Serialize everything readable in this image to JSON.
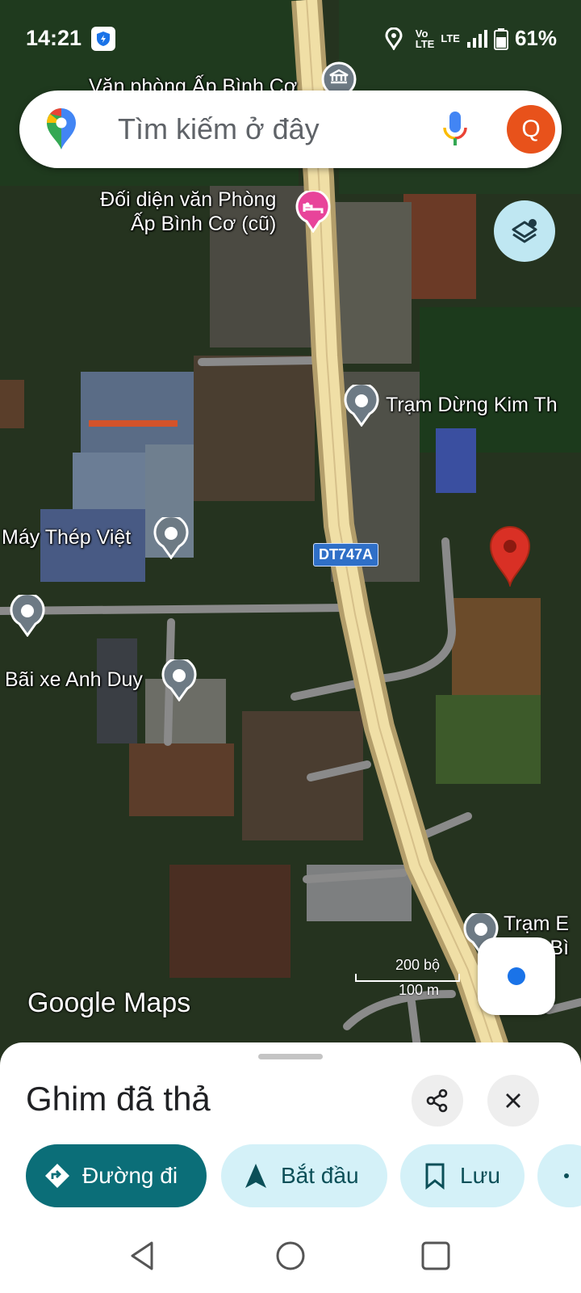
{
  "status_bar": {
    "time": "14:21",
    "battery": "61%",
    "network_label": "LTE"
  },
  "search": {
    "placeholder": "Tìm kiếm ở đây",
    "avatar_letter": "Q"
  },
  "map": {
    "road_shield": "DT747A",
    "google_logo": "Google Maps",
    "scale_top": "200 bộ",
    "scale_bottom": "100 m",
    "pois": [
      {
        "label": "Văn phòng Ấp Bình Cơ"
      },
      {
        "label": "Đối diện văn Phòng",
        "label2": "Ấp Bình Cơ (cũ)"
      },
      {
        "label": "Trạm Dừng Kim Th"
      },
      {
        "label": "Máy Thép Việt"
      },
      {
        "label": "Bãi xe Anh Duy"
      },
      {
        "label": "Trạm E",
        "label2": "Bì"
      }
    ]
  },
  "sheet": {
    "title": "Ghim đã thả",
    "actions": [
      {
        "label": "Đường đi",
        "icon": "directions-icon",
        "color": "#0b6e78"
      },
      {
        "label": "Bắt đầu",
        "icon": "navigation-arrow-icon"
      },
      {
        "label": "Lưu",
        "icon": "bookmark-icon"
      }
    ]
  },
  "colors": {
    "accent_teal": "#0b6e78",
    "chip_bg": "#d4f1f8",
    "pin_red": "#d93025",
    "avatar_orange": "#e8521b"
  }
}
